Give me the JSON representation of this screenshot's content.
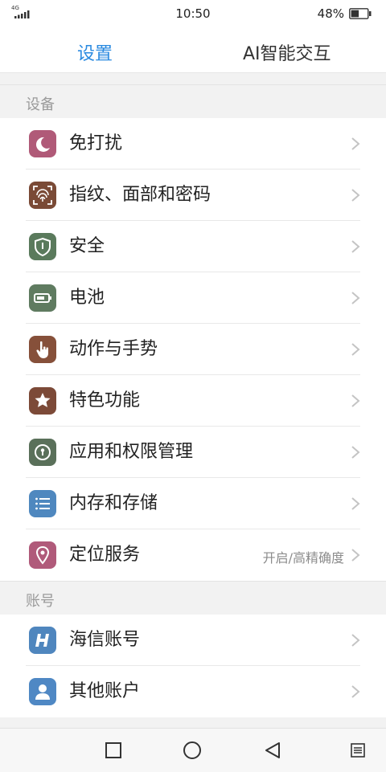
{
  "status_bar": {
    "network": "4G",
    "time": "10:50",
    "battery_percent": "48%",
    "battery_level": 0.48
  },
  "header": {
    "tabs": [
      {
        "label": "设置",
        "active": true
      },
      {
        "label": "AI智能交互",
        "active": false
      }
    ]
  },
  "sections": [
    {
      "title": "设备",
      "items": [
        {
          "label": "免打扰",
          "icon": "moon-icon",
          "color": "#b05a78"
        },
        {
          "label": "指纹、面部和密码",
          "icon": "fingerprint-icon",
          "color": "#7a4a36"
        },
        {
          "label": "安全",
          "icon": "shield-icon",
          "color": "#5a7a5c"
        },
        {
          "label": "电池",
          "icon": "battery-icon",
          "color": "#5f7b60"
        },
        {
          "label": "动作与手势",
          "icon": "hand-gesture-icon",
          "color": "#86503a"
        },
        {
          "label": "特色功能",
          "icon": "star-icon",
          "color": "#7c4a38"
        },
        {
          "label": "应用和权限管理",
          "icon": "app-permission-icon",
          "color": "#5a705a"
        },
        {
          "label": "内存和存储",
          "icon": "storage-list-icon",
          "color": "#4f88bf"
        },
        {
          "label": "定位服务",
          "icon": "location-pin-icon",
          "color": "#b05a7a",
          "value": "开启/高精确度"
        }
      ]
    },
    {
      "title": "账号",
      "items": [
        {
          "label": "海信账号",
          "icon": "hisense-account-icon",
          "color": "#4f86be"
        },
        {
          "label": "其他账户",
          "icon": "person-icon",
          "color": "#4f88c4"
        }
      ]
    }
  ],
  "colors": {
    "accent": "#2a8ae0",
    "background": "#f2f2f2",
    "section_title": "#9a9a9a"
  }
}
